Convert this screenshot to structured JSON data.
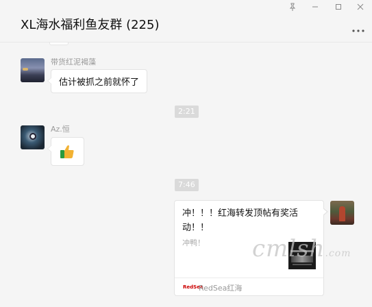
{
  "window": {
    "title": "XL海水福利鱼友群 (225)",
    "controls": {
      "pin": "pin-icon",
      "minimize": "minimize-icon",
      "maximize": "maximize-icon",
      "close": "close-icon"
    },
    "more_icon": "more-icon"
  },
  "messages": [
    {
      "type": "text",
      "sender": "带货红泥褐藻",
      "text": "估计被抓之前就怀了"
    },
    {
      "type": "time",
      "text": "2:21"
    },
    {
      "type": "emoji",
      "sender": "Az.恒",
      "emoji": "thumbs-up-icon"
    },
    {
      "type": "time",
      "text": "7:46"
    },
    {
      "type": "link_card",
      "from_self": true,
      "title": "冲！！！红海转发顶帖有奖活动！！",
      "description": "冲鸭！",
      "source_logo": "RedSea",
      "source": "RedSea红海"
    }
  ],
  "watermark": {
    "main": "cmlsh",
    "suffix": ".com"
  },
  "colors": {
    "background": "#f5f5f5",
    "bubble": "#ffffff",
    "time_badge": "#dadada",
    "thumb": "#f2b233",
    "thumb_cuff": "#2a9a3e"
  }
}
